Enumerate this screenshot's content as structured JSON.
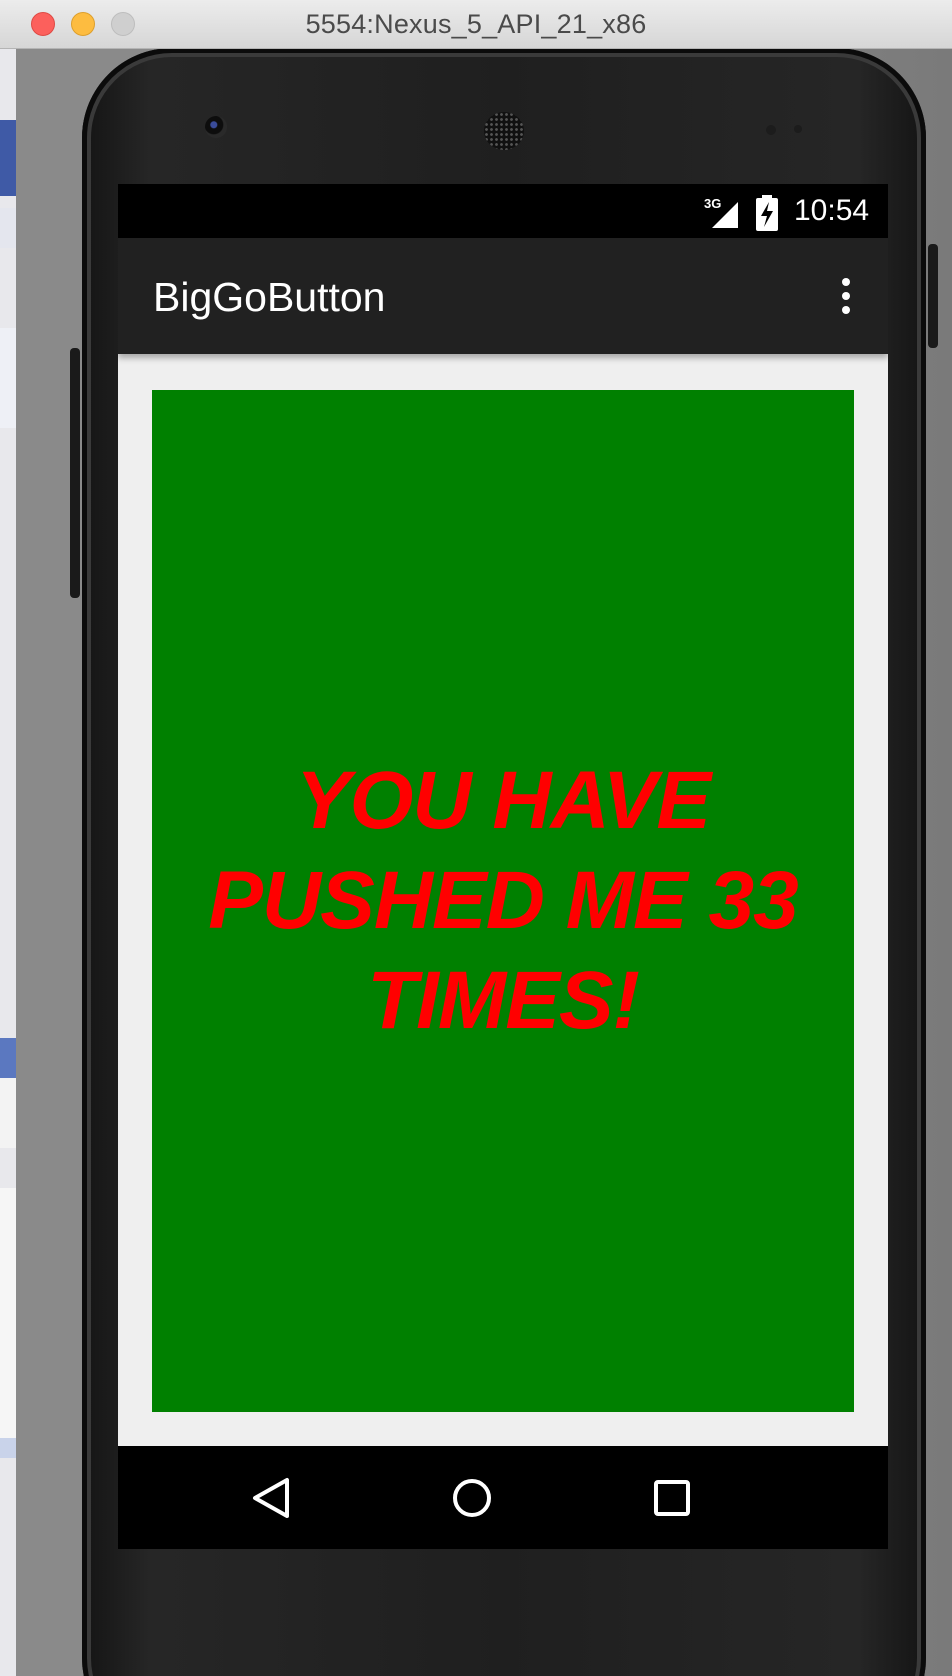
{
  "window": {
    "title": "5554:Nexus_5_API_21_x86"
  },
  "status_bar": {
    "network_type": "3G",
    "time": "10:54",
    "icons": [
      "signal-icon",
      "battery-charging-icon"
    ]
  },
  "app_bar": {
    "title": "BigGoButton",
    "overflow_icon": "more-vert-icon"
  },
  "main": {
    "button_text": "YOU HAVE PUSHED ME 33 TIMES!",
    "button_color": "#008000",
    "text_color": "#ff0000"
  },
  "nav_bar": {
    "buttons": [
      "back-icon",
      "home-icon",
      "recents-icon"
    ]
  },
  "colors": {
    "app_bar": "#212121",
    "status_bar": "#000000",
    "screen_background": "#efefef"
  }
}
